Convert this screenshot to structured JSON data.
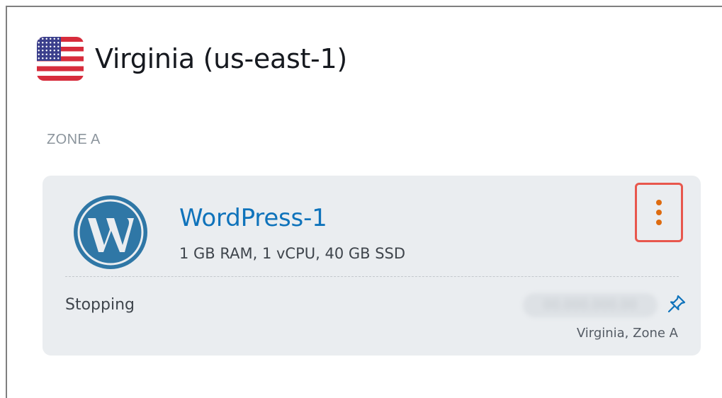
{
  "region": {
    "flag_icon": "us-flag-icon",
    "title": "Virginia (us-east-1)"
  },
  "zone": {
    "label": "ZONE A"
  },
  "instance": {
    "logo_icon": "wordpress-logo-icon",
    "name": "WordPress-1",
    "specs": "1 GB RAM, 1 vCPU, 40 GB SSD",
    "menu_icon": "vertical-ellipsis-icon",
    "status": "Stopping",
    "ip_address": "00.000.000.00",
    "pin_icon": "pin-icon",
    "location": "Virginia, Zone A"
  },
  "colors": {
    "link_blue": "#0f73bb",
    "menu_orange": "#dd6b10",
    "highlight_red": "#e8574d",
    "card_bg": "#eaedf0",
    "wordpress_blue": "#2f77a6"
  }
}
